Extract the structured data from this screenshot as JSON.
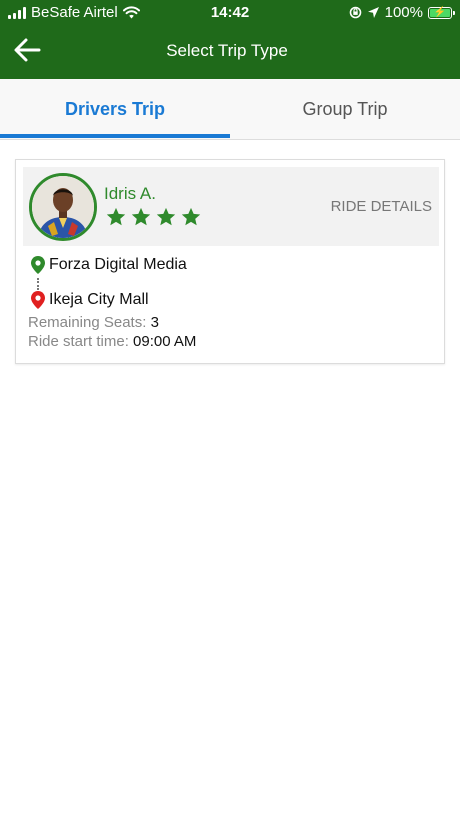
{
  "status_bar": {
    "carrier": "BeSafe Airtel",
    "time": "14:42",
    "battery": "100%"
  },
  "header": {
    "title": "Select Trip Type"
  },
  "tabs": [
    {
      "label": "Drivers Trip",
      "active": true
    },
    {
      "label": "Group Trip",
      "active": false
    }
  ],
  "trip_card": {
    "driver_name": "Idris A.",
    "rating_stars": 4,
    "ride_details_label": "RIDE DETAILS",
    "from": "Forza Digital Media",
    "to": "Ikeja City Mall",
    "remaining_seats_label": "Remaining Seats:",
    "remaining_seats_value": "3",
    "start_time_label": "Ride start time:",
    "start_time_value": "09:00 AM"
  },
  "colors": {
    "header_green": "#1f6a1a",
    "accent_green": "#2f8a2c",
    "tab_blue": "#1a7ad4",
    "pin_red": "#e02020"
  }
}
